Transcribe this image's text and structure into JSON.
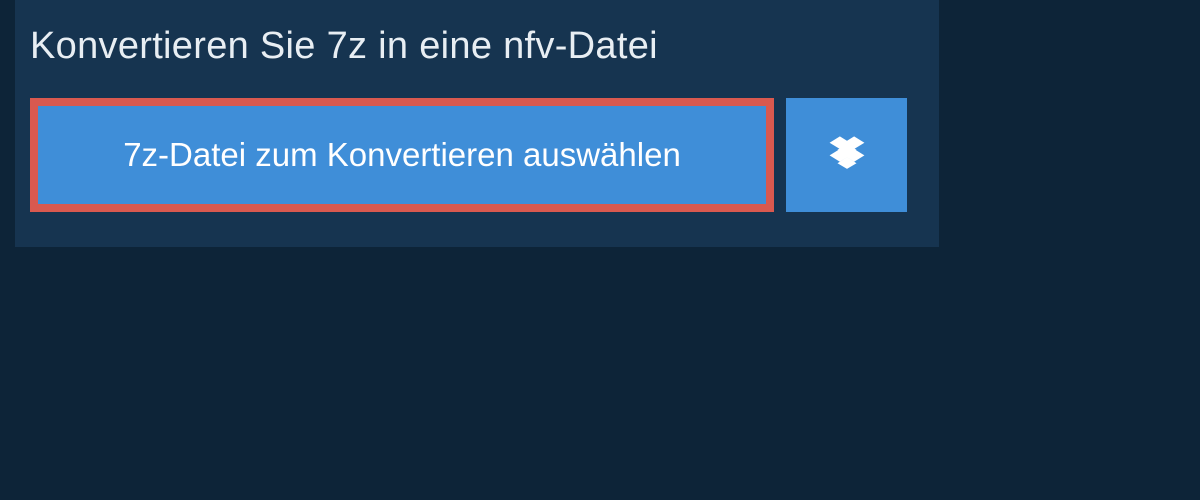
{
  "header": {
    "title": "Konvertieren Sie 7z in eine nfv-Datei"
  },
  "actions": {
    "select_file_label": "7z-Datei zum Konvertieren auswählen"
  },
  "colors": {
    "background_outer": "#0d2438",
    "background_panel": "#163450",
    "button_primary": "#3f8ed8",
    "highlight_border": "#d9594f",
    "text_light": "#e8eef3"
  }
}
